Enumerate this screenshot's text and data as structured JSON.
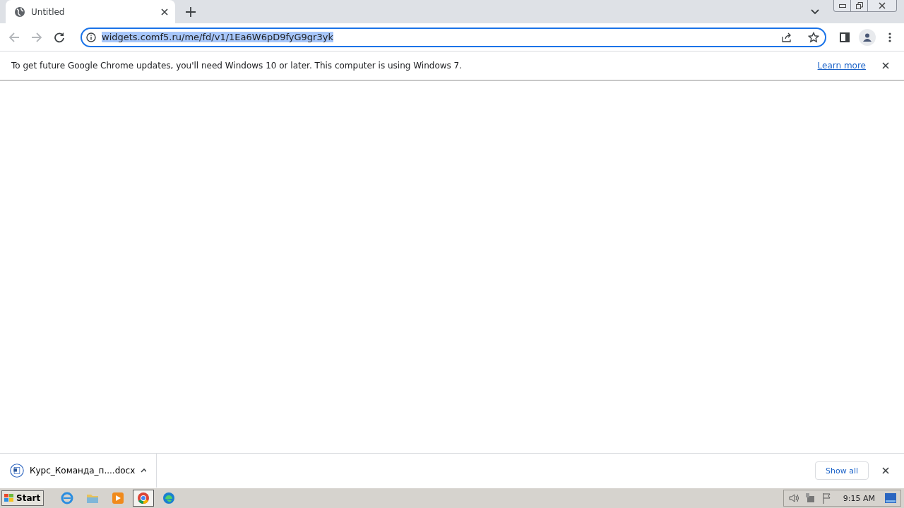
{
  "tabs": [
    {
      "title": "Untitled",
      "selected": true
    }
  ],
  "address_bar": {
    "url": "widgets.comf5.ru/me/fd/v1/1Ea6W6pD9fyG9gr3yk",
    "selected": true
  },
  "infobar": {
    "message": "To get future Google Chrome updates, you'll need Windows 10 or later. This computer is using Windows 7.",
    "link": "Learn more"
  },
  "download_shelf": {
    "items": [
      {
        "filename": "Курс_Команда_п....docx"
      }
    ],
    "show_all": "Show all"
  },
  "taskbar": {
    "start": "Start",
    "apps": [
      {
        "kind": "ie",
        "selected": false
      },
      {
        "kind": "folder",
        "selected": false
      },
      {
        "kind": "media",
        "selected": false
      },
      {
        "kind": "chrome",
        "selected": true
      },
      {
        "kind": "edge",
        "selected": false
      }
    ],
    "clock": "9:15 AM"
  }
}
